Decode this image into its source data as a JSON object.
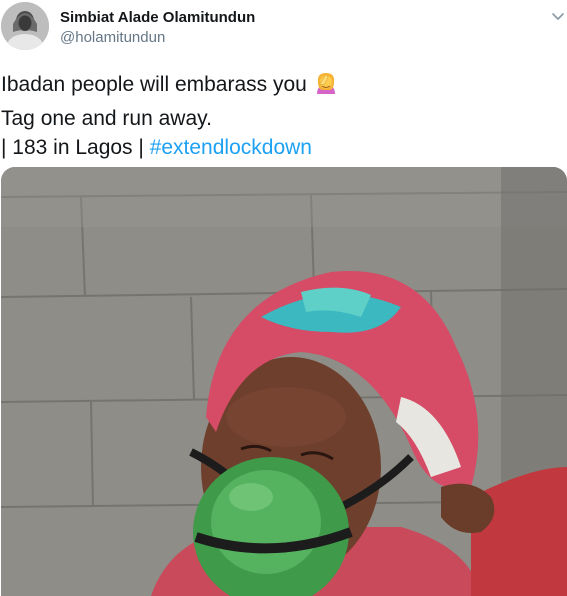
{
  "tweet": {
    "author_name": "Simbiat Alade Olamitundun",
    "author_handle": "@holamitundun",
    "text_line1": "Ibadan people will embarass you",
    "text_line2": "Tag one and run away.",
    "text_line3_prefix": "| 183 in Lagos | ",
    "hashtag": "#extendlockdown",
    "emoji_icon": "woman-facepalming-emoji",
    "hashtag_color": "#1da1f2"
  }
}
